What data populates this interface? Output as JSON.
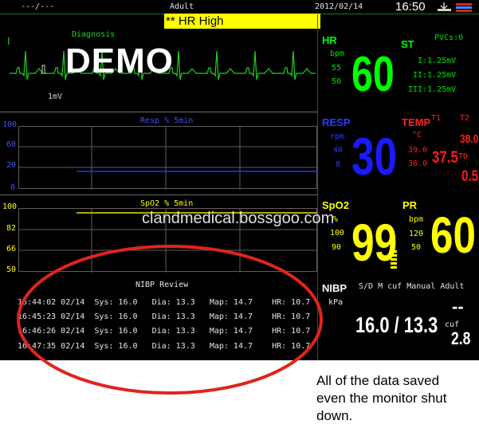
{
  "header": {
    "bed": "---/---",
    "patient_type": "Adult",
    "date": "2012/02/14",
    "time": "16:50",
    "alarm": "** HR High"
  },
  "ecg": {
    "lead": "I",
    "mode": "Diagnosis",
    "scale": "1mV",
    "demo": "DEMO"
  },
  "resp_trend": {
    "title": "Resp % 5min",
    "ticks": [
      "100",
      "60",
      "20",
      "0"
    ]
  },
  "spo2_trend": {
    "title": "SpO2 % 5min",
    "ticks": [
      "100",
      "82",
      "66",
      "50"
    ]
  },
  "nibp_review": {
    "title": "NIBP Review",
    "rows": [
      "16:44:02 02/14  Sys: 16.0   Dia: 13.3   Map: 14.7    HR: 10.7",
      "16:45:23 02/14  Sys: 16.0   Dia: 13.3   Map: 14.7    HR: 10.7",
      "16:46:26 02/14  Sys: 16.0   Dia: 13.3   Map: 14.7    HR: 10.7",
      "16:47:35 02/14  Sys: 16.0   Dia: 13.3   Map: 14.7    HR: 10.7"
    ]
  },
  "params": {
    "hr": {
      "label": "HR",
      "unit": "bpm",
      "hi": "55",
      "lo": "50",
      "value": "60"
    },
    "st": {
      "label": "ST",
      "pvcs": "PVCs:0",
      "i": "I:1.25mV",
      "ii": "II:1.25mV",
      "iii": "III:1.25mV"
    },
    "resp": {
      "label": "RESP",
      "unit": "rpm",
      "hi": "40",
      "lo": "8",
      "value": "30"
    },
    "temp": {
      "label": "TEMP",
      "unit": "°C",
      "hi": "39.0",
      "lo": "36.0",
      "t1_label": "T1",
      "t2_label": "T2",
      "t1": "37.5",
      "t2": "38.0",
      "td_label": "TD",
      "td": "0.5"
    },
    "spo2": {
      "label": "SpO2",
      "unit": "%",
      "hi": "100",
      "lo": "90",
      "value": "99"
    },
    "pr": {
      "label": "PR",
      "unit": "bpm",
      "hi": "120",
      "lo": "50",
      "value": "60"
    },
    "nibp": {
      "label": "NIBP",
      "unit": "kPa",
      "mode": "S/D M cuf Manual Adult",
      "value": "16.0 / 13.3",
      "dash": "--",
      "cuf_label": "cuf",
      "cuf": "2.8"
    }
  },
  "watermark": "clandmedical.bossgoo.com",
  "caption": [
    "All of the data saved",
    "even the monitor shut",
    "down."
  ],
  "colors": {
    "hr": "#00ff00",
    "resp": "#1a1aff",
    "spo2": "#ffff00",
    "temp": "#ff1a1a",
    "alarm_bg": "#ffff00",
    "ecg": "#1fd11f",
    "annotation": "#e0241b"
  }
}
